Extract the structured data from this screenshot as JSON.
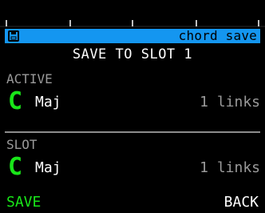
{
  "header": {
    "icon": "floppy-disk-icon",
    "title": "chord save",
    "background": "#1496f0"
  },
  "subtitle": "SAVE TO SLOT 1",
  "active": {
    "label": "ACTIVE",
    "root": "C",
    "quality": "Maj",
    "links": "1 links"
  },
  "slot": {
    "label": "SLOT",
    "root": "C",
    "quality": "Maj",
    "links": "1 links"
  },
  "softkeys": {
    "left": "SAVE",
    "right": "BACK"
  },
  "colors": {
    "accent_green": "#19e619",
    "header_blue": "#1496f0",
    "muted_gray": "#9a9a9a"
  }
}
